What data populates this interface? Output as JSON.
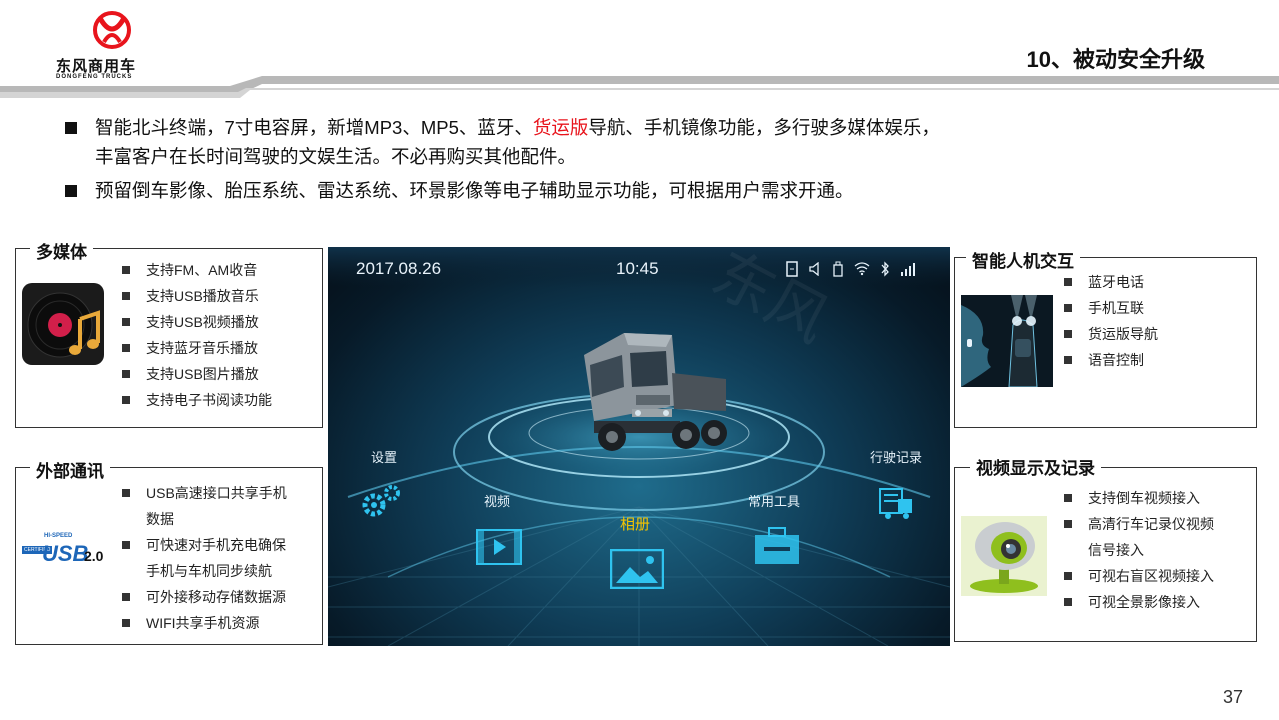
{
  "header": {
    "logo_cn": "东风商用车",
    "logo_en": "DONGFENG TRUCKS",
    "title": "10、被动安全升级"
  },
  "bullets": [
    {
      "line1_part1": "智能北斗终端，7寸电容屏，新增MP3、MP5、蓝牙、",
      "line1_red": "货运版",
      "line1_part2": "导航、手机镜像功能，多行驶多媒体娱乐，",
      "line2": "丰富客户在长时间驾驶的文娱生活。不必再购买其他配件。"
    },
    {
      "line1": "预留倒车影像、胎压系统、雷达系统、环景影像等电子辅助显示功能，可根据用户需求开通。"
    }
  ],
  "multimedia": {
    "title": "多媒体",
    "items": [
      "支持FM、AM收音",
      "支持USB播放音乐",
      "支持USB视频播放",
      "支持蓝牙音乐播放",
      "支持USB图片播放",
      "支持电子书阅读功能"
    ]
  },
  "external": {
    "title": "外部通讯",
    "items": [
      {
        "l1": "USB高速接口共享手机",
        "l2": "数据"
      },
      {
        "l1": "可快速对手机充电确保",
        "l2": "手机与车机同步续航"
      },
      {
        "l1": "可外接移动存储数据源",
        "l2": ""
      },
      {
        "l1": "WIFI共享手机资源",
        "l2": ""
      }
    ],
    "usb_top": "HI-SPEED",
    "usb_certified": "CERTIFIED",
    "usb_main": "USB",
    "usb_ver": "2.0"
  },
  "interaction": {
    "title": "智能人机交互",
    "items": [
      "蓝牙电话",
      "手机互联",
      "货运版导航",
      "语音控制"
    ]
  },
  "video": {
    "title": "视频显示及记录",
    "items": [
      {
        "l1": "支持倒车视频接入",
        "l2": ""
      },
      {
        "l1": "高清行车记录仪视频",
        "l2": "信号接入"
      },
      {
        "l1": "可视右盲区视频接入",
        "l2": ""
      },
      {
        "l1": "可视全景影像接入",
        "l2": ""
      }
    ]
  },
  "screen": {
    "date": "2017.08.26",
    "time": "10:45",
    "menu": {
      "settings": "设置",
      "video": "视频",
      "album": "相册",
      "tools": "常用工具",
      "drive_record": "行驶记录"
    },
    "accent": "#2fc3ef",
    "highlight": "#f5c400"
  },
  "page_number": "37"
}
